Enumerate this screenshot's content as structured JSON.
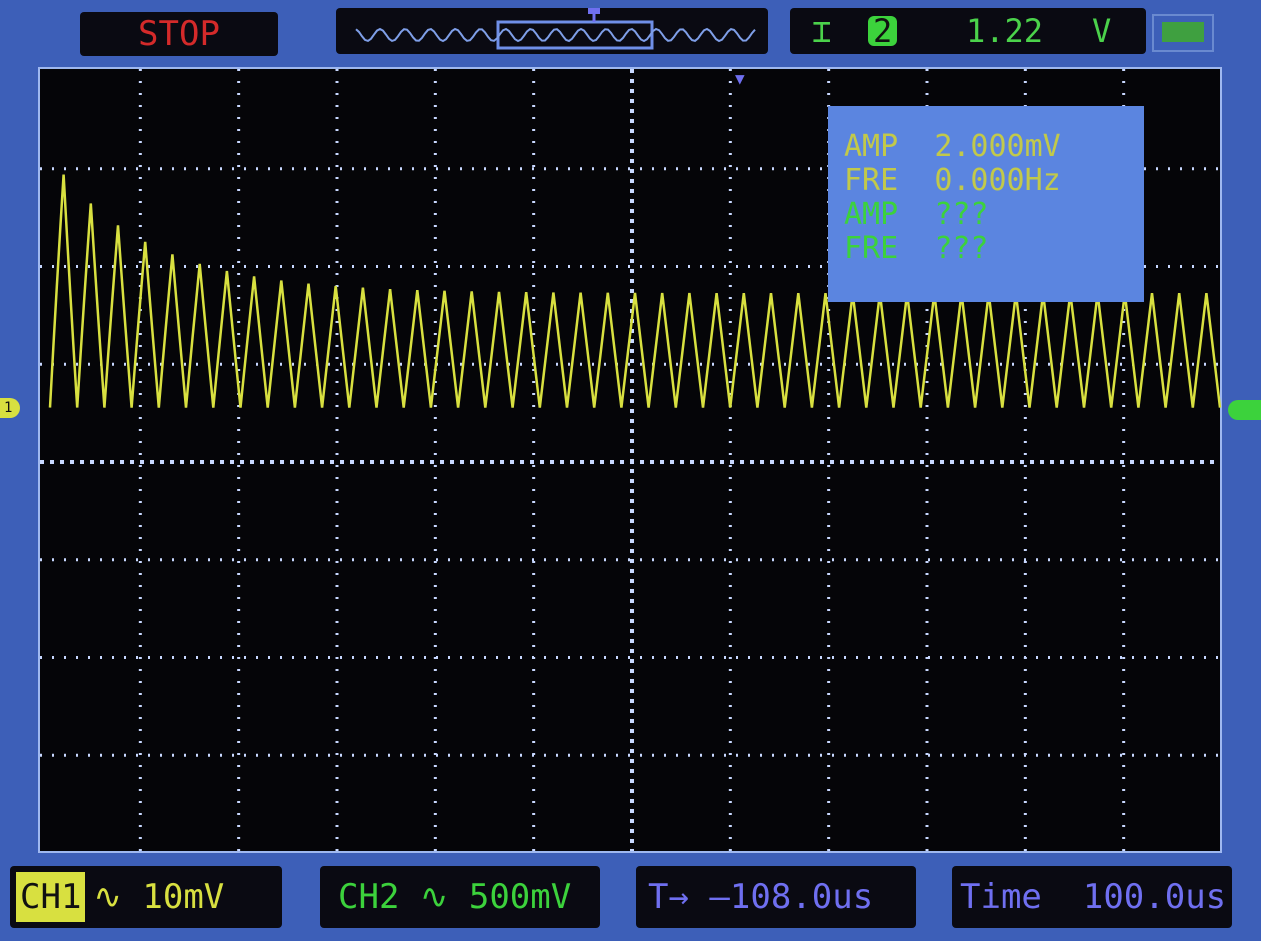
{
  "top_bar": {
    "run_state": "STOP",
    "cursor_icon": "ibeam-cursor-icon",
    "channel_number": "2",
    "trigger_level": "1.22",
    "trigger_unit": "V"
  },
  "measurements": [
    {
      "label": "AMP",
      "value": "2.000mV",
      "channel": "CH1"
    },
    {
      "label": "FRE",
      "value": "0.000Hz",
      "channel": "CH1"
    },
    {
      "label": "AMP",
      "value": "???",
      "channel": "CH2"
    },
    {
      "label": "FRE",
      "value": "???",
      "channel": "CH2"
    }
  ],
  "channel1_marker": "1",
  "bottom_bar": {
    "ch1_label": "CH1",
    "ch1_scale": "∿ 10mV",
    "ch2_label": "CH2",
    "ch2_scale": "∿ 500mV",
    "trigger_offset": "T→ –108.0us",
    "timebase_label": "Time",
    "timebase_value": "100.0us"
  },
  "colors": {
    "ch1": "#d8e040",
    "ch2": "#3cd23c",
    "grid": "#c8d8ff",
    "frame": "#3d5fb8"
  },
  "chart_data": {
    "type": "line",
    "x_divisions": 12,
    "y_divisions": 8,
    "series": [
      {
        "name": "CH1",
        "cycles": 43,
        "start_high_div": 2.4,
        "settled_high_div": 0.85,
        "low_div": -0.45
      }
    ]
  }
}
